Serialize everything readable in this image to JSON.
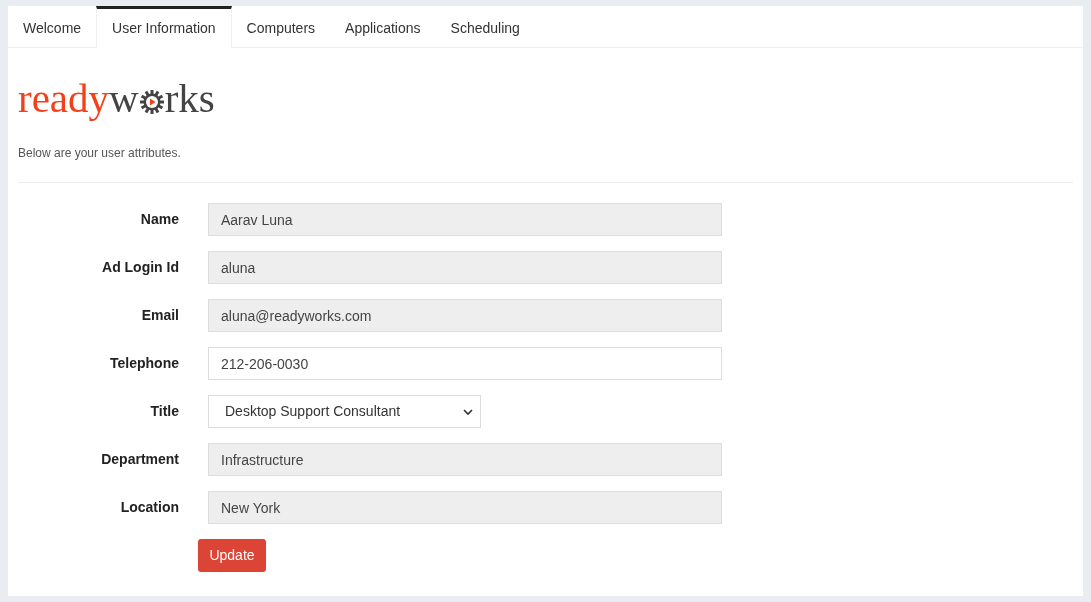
{
  "tabs": [
    {
      "label": "Welcome",
      "selected": false
    },
    {
      "label": "User Information",
      "selected": true
    },
    {
      "label": "Computers",
      "selected": false
    },
    {
      "label": "Applications",
      "selected": false
    },
    {
      "label": "Scheduling",
      "selected": false
    }
  ],
  "logo": {
    "lead": "ready",
    "middle": "w",
    "tail": "rks"
  },
  "intro": "Below are your user attributes.",
  "fields": [
    {
      "label": "Name",
      "kind": "readonly",
      "value": "Aarav Luna"
    },
    {
      "label": "Ad Login Id",
      "kind": "readonly",
      "value": "aluna"
    },
    {
      "label": "Email",
      "kind": "readonly",
      "value": "aluna@readyworks.com"
    },
    {
      "label": "Telephone",
      "kind": "input",
      "value": "212-206-0030"
    },
    {
      "label": "Title",
      "kind": "select",
      "value": "Desktop Support Consultant"
    },
    {
      "label": "Department",
      "kind": "readonly",
      "value": "Infrastructure"
    },
    {
      "label": "Location",
      "kind": "readonly",
      "value": "New York"
    }
  ],
  "button": "Update"
}
